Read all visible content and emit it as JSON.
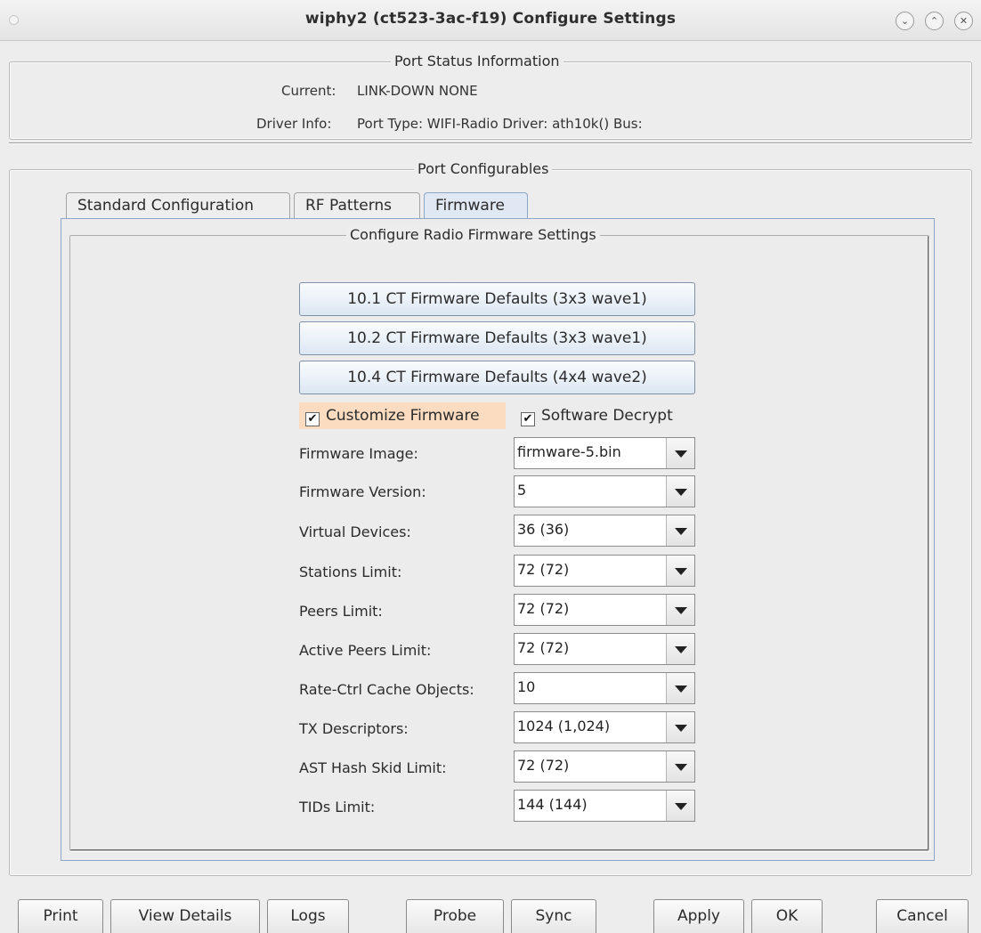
{
  "window": {
    "title": "wiphy2  (ct523-3ac-f19) Configure Settings"
  },
  "status": {
    "group_title": "Port Status Information",
    "current_label": "Current:",
    "current_value": "LINK-DOWN  NONE",
    "driver_label": "Driver Info:",
    "driver_value": "Port Type: WIFI-Radio   Driver: ath10k()  Bus:"
  },
  "config": {
    "group_title": "Port Configurables",
    "tabs": [
      {
        "label": "Standard Configuration"
      },
      {
        "label": "RF Patterns"
      },
      {
        "label": "Firmware"
      }
    ],
    "active_tab": "Firmware"
  },
  "firmware": {
    "group_title": "Configure Radio Firmware Settings",
    "preset_buttons": [
      {
        "label": "10.1 CT Firmware Defaults  (3x3 wave1)"
      },
      {
        "label": "10.2 CT Firmware Defaults  (3x3 wave1)"
      },
      {
        "label": "10.4 CT Firmware Defaults  (4x4 wave2)"
      }
    ],
    "customize": {
      "label": "Customize Firmware",
      "checked": true
    },
    "software_decrypt": {
      "label": "Software Decrypt",
      "checked": true
    },
    "check_glyph": "✔",
    "fields": [
      {
        "label": "Firmware Image:",
        "value": "firmware-5.bin"
      },
      {
        "label": "Firmware Version:",
        "value": "5"
      },
      {
        "label": "Virtual Devices:",
        "value": "36 (36)"
      },
      {
        "label": "Stations Limit:",
        "value": "72 (72)"
      },
      {
        "label": "Peers Limit:",
        "value": "72 (72)"
      },
      {
        "label": "Active Peers Limit:",
        "value": "72 (72)"
      },
      {
        "label": "Rate-Ctrl Cache Objects:",
        "value": "10"
      },
      {
        "label": "TX Descriptors:",
        "value": "1024 (1,024)"
      },
      {
        "label": "AST Hash Skid Limit:",
        "value": "72 (72)"
      },
      {
        "label": "TIDs Limit:",
        "value": "144 (144)"
      }
    ]
  },
  "buttons": {
    "print": "Print",
    "view_details": "View Details",
    "logs": "Logs",
    "probe": "Probe",
    "sync": "Sync",
    "apply": "Apply",
    "ok": "OK",
    "cancel": "Cancel"
  },
  "window_controls": {
    "minimize": "⌄",
    "maximize": "⌃",
    "close": "✕"
  },
  "colors": {
    "highlight": "#fbdcc0",
    "tab_active": "#dfe8f3",
    "button_top": "#fafcfe",
    "button_bottom": "#dce7f3"
  }
}
